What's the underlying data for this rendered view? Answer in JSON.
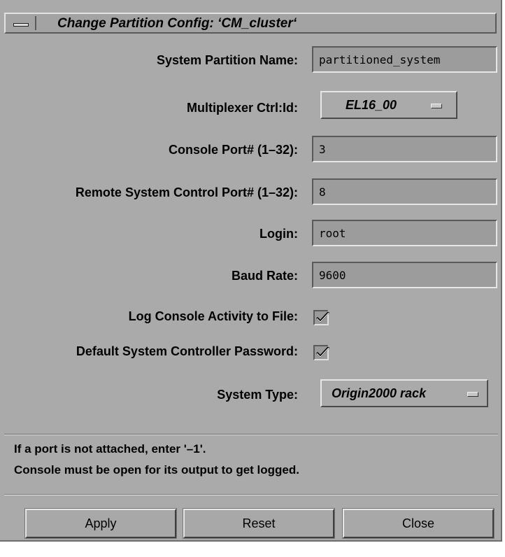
{
  "window": {
    "title": "Change Partition Config: ‘CM_cluster‘"
  },
  "form": {
    "partition_name_label": "System Partition Name:",
    "partition_name_value": "partitioned_system",
    "mux_label": "Multiplexer Ctrl:Id:",
    "mux_value": "EL16_00",
    "console_port_label": "Console Port# (1–32):",
    "console_port_value": "3",
    "remote_port_label": "Remote System Control Port# (1–32):",
    "remote_port_value": "8",
    "login_label": "Login:",
    "login_value": "root",
    "baud_label": "Baud Rate:",
    "baud_value": "9600",
    "log_console_label": "Log Console Activity to File:",
    "log_console_checked": true,
    "default_pw_label": "Default System Controller Password:",
    "default_pw_checked": true,
    "system_type_label": "System Type:",
    "system_type_value": "Origin2000 rack"
  },
  "info": {
    "line1": "If a port is not attached, enter '–1'.",
    "line2": "Console must be open for its output to get logged."
  },
  "buttons": {
    "apply": "Apply",
    "reset": "Reset",
    "close": "Close"
  },
  "colors": {
    "panel": "#aaaaaa",
    "field": "#9c9c9c"
  }
}
